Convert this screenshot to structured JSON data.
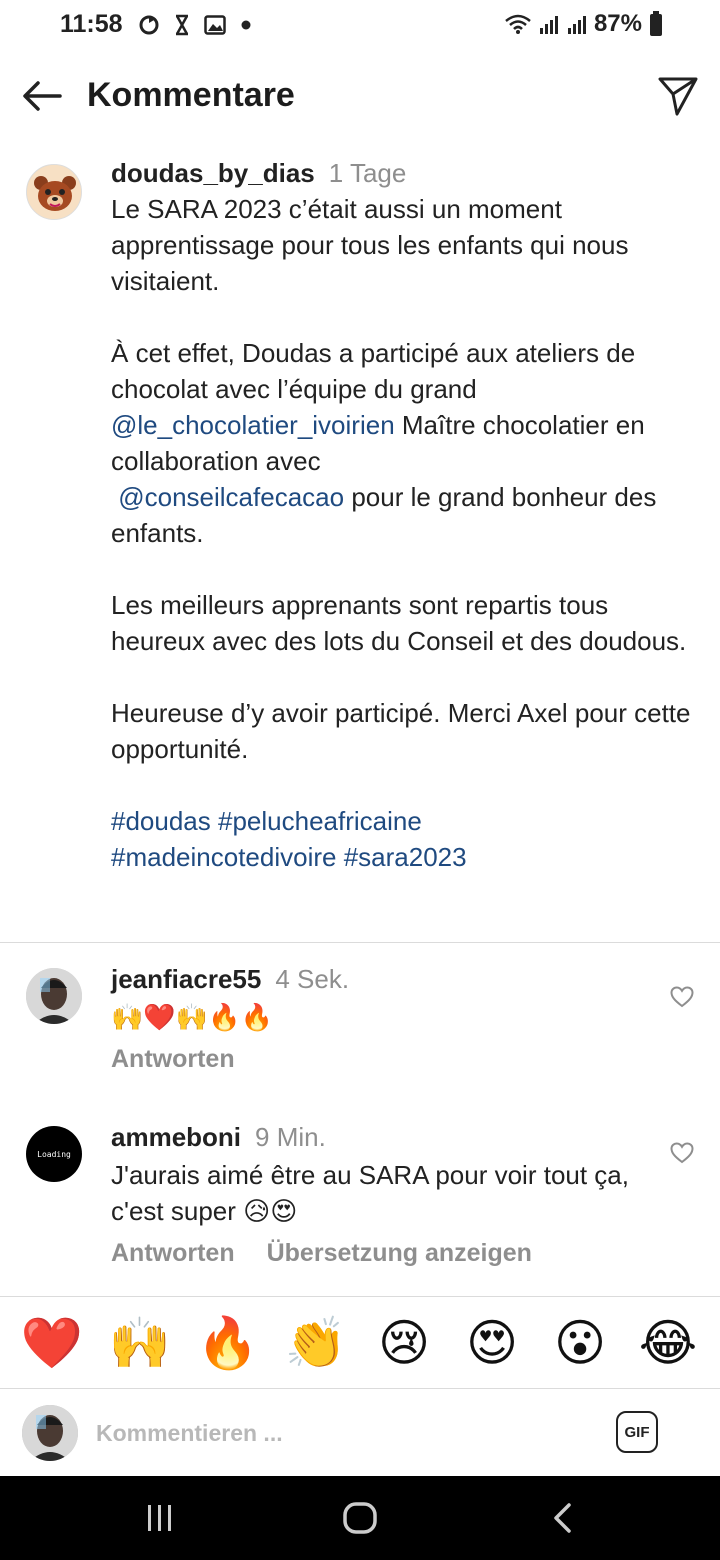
{
  "status_bar": {
    "time": "11:58",
    "battery_percent": "87%",
    "icons": [
      "sync-icon",
      "hourglass-icon",
      "image-icon",
      "dot-icon",
      "wifi-icon",
      "signal-icon",
      "signal-icon",
      "battery-icon"
    ]
  },
  "header": {
    "title": "Kommentare",
    "back_icon": "arrow-left-icon",
    "send_icon": "paper-plane-icon"
  },
  "caption": {
    "username": "doudas_by_dias",
    "time": "1 Tage",
    "paragraph_1": "Le SARA 2023 c’était aussi un moment apprentissage pour tous les enfants qui nous visitaient.",
    "paragraph_2_part_1": "À cet effet, Doudas a participé aux ateliers de chocolat avec l’équipe du grand",
    "mention_1": "@le_chocolatier_ivoirien",
    "paragraph_2_part_2": "Maître chocolatier en collaboration avec",
    "mention_2": "@conseilcafecacao",
    "paragraph_2_part_3": "pour le grand bonheur des enfants.",
    "paragraph_3": "Les meilleurs apprenants sont repartis tous heureux avec des lots du Conseil et des doudous.",
    "paragraph_4": "Heureuse d’y avoir participé. Merci Axel pour cette opportunité.",
    "hashtags": [
      "#doudas",
      "#pelucheafricaine",
      "#madeincotedivoire",
      "#sara2023"
    ]
  },
  "comments": [
    {
      "username": "jeanfiacre55",
      "time": "4 Sek.",
      "text": "🙌❤️🙌🔥🔥",
      "reply_label": "Antworten"
    },
    {
      "username": "ammeboni",
      "time": "9 Min.",
      "text": "J'aurais aimé être au SARA pour voir tout ça, c'est super 😥😍",
      "reply_label": "Antworten",
      "translate_label": "Übersetzung anzeigen",
      "avatar_text": "Loading"
    }
  ],
  "emoji_bar": [
    "❤️",
    "🙌",
    "🔥",
    "👏",
    "😢",
    "😍",
    "😮",
    "😂"
  ],
  "input": {
    "placeholder": "Kommentieren ...",
    "gif_label": "GIF"
  }
}
